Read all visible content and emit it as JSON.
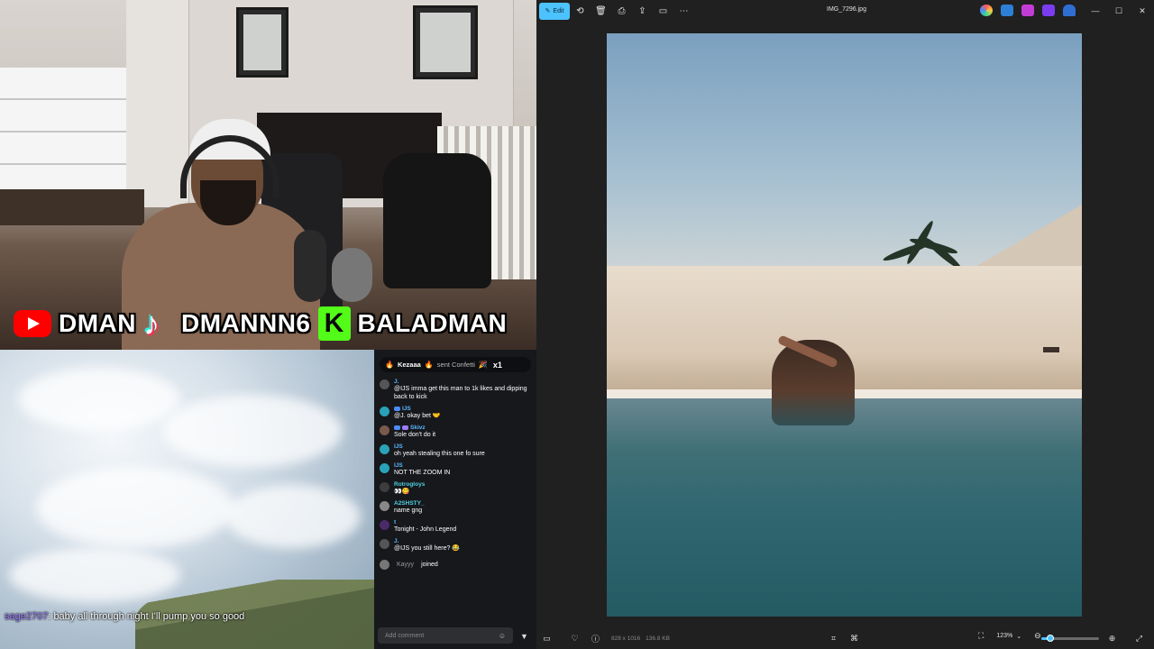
{
  "stream": {
    "socials": [
      {
        "platform_icon": "youtube-icon",
        "handle": "DMAN"
      },
      {
        "platform_icon": "tiktok-icon",
        "handle": "DMANNN6"
      },
      {
        "platform_icon": "kick-icon",
        "handle": "BALADMAN"
      }
    ],
    "overlay_chat": {
      "user": "sage2707",
      "message": ": baby all through night I'll pump you so good"
    }
  },
  "chat": {
    "gift": {
      "user": "Kezaaa",
      "action": "sent Confetti",
      "count": "x1"
    },
    "messages": [
      {
        "user": "J.",
        "text": "@IJS imma get this man to 1k likes and dipping back to kick"
      },
      {
        "user": "IJS",
        "text": "@J. okay bet 🤝"
      },
      {
        "user": "Skivz",
        "text": "Sole don't do it"
      },
      {
        "user": "IJS",
        "text": "oh yeah stealing this one fo sure"
      },
      {
        "user": "IJS",
        "text": "NOT THE ZOOM IN"
      },
      {
        "user": "Rotrogloys",
        "text": "👀😋"
      },
      {
        "user": "A2SHSTY_",
        "text": "name gng"
      },
      {
        "user": "t",
        "text": "Tonight - John Legend"
      },
      {
        "user": "J.",
        "text": "@IJS you still here? 😂"
      }
    ],
    "join": {
      "user": "Kayyy",
      "text": "joined"
    },
    "input_placeholder": "Add comment"
  },
  "viewer": {
    "edit_label": "Edit",
    "filename": "IMG_7296.jpg",
    "dimensions": "828 x 1016",
    "filesize": "136.8 KB",
    "zoom": "123%",
    "zoom_slider_fraction": 0.15,
    "accent": "#4cc2ff"
  }
}
